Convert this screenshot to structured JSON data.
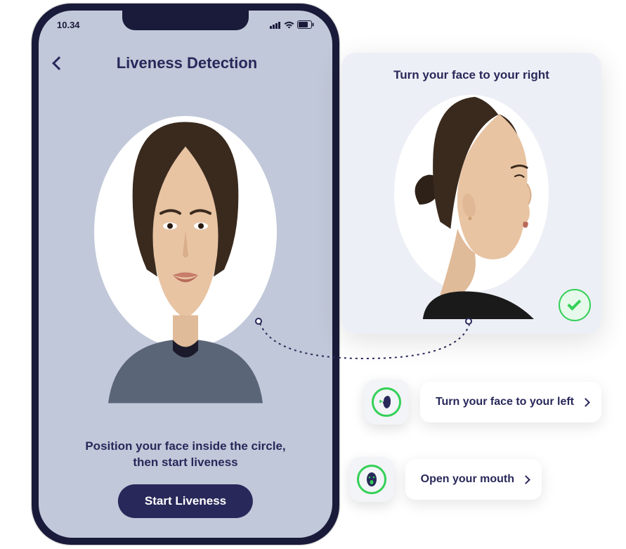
{
  "status": {
    "time": "10.34"
  },
  "header": {
    "title": "Liveness Detection"
  },
  "main": {
    "instruction": "Position your face inside the circle, then start liveness",
    "start_button": "Start Liveness"
  },
  "callout": {
    "title": "Turn your face to your right"
  },
  "actions": {
    "turn_left": "Turn your face to your left",
    "open_mouth": "Open your mouth"
  }
}
